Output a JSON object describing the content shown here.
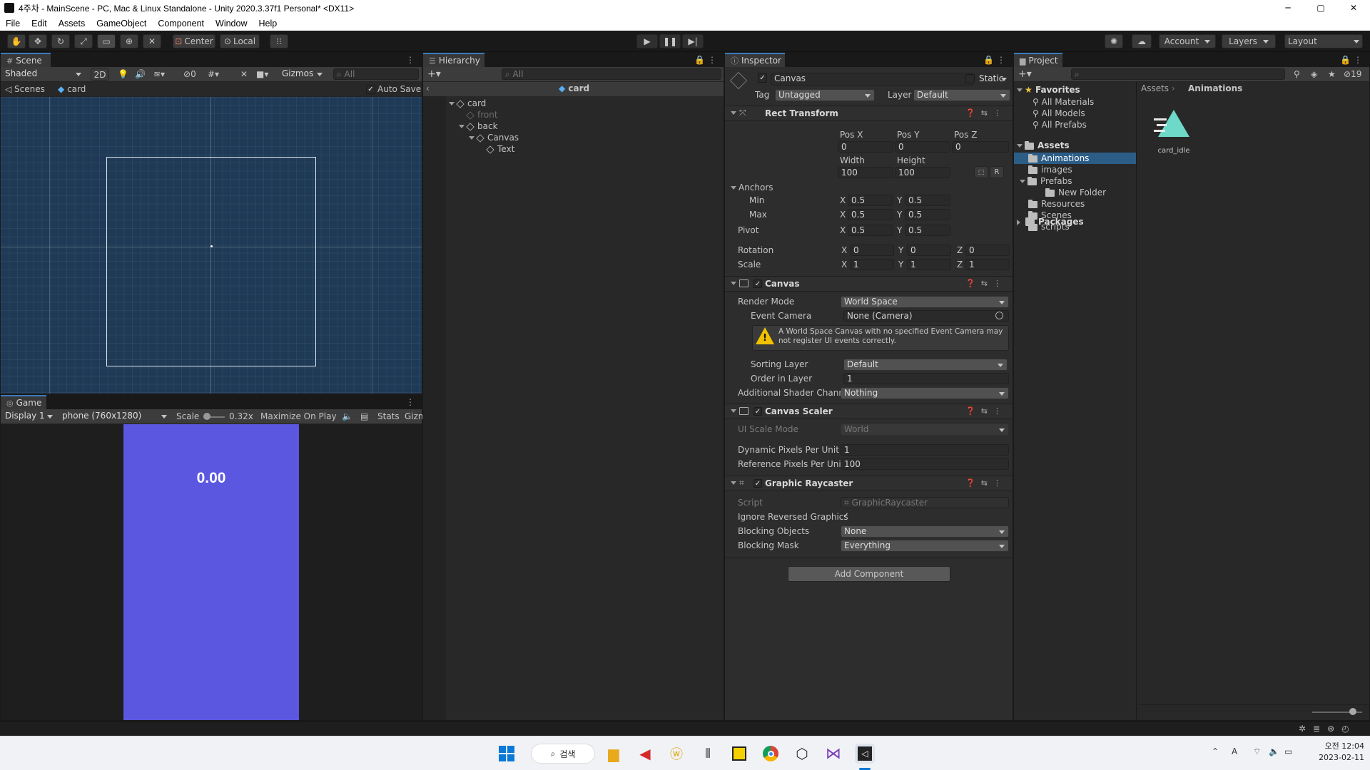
{
  "window": {
    "title": "4주차 - MainScene - PC, Mac & Linux Standalone - Unity 2020.3.37f1 Personal* <DX11>",
    "controls": [
      "─",
      "▢",
      "✕"
    ]
  },
  "menu": [
    "File",
    "Edit",
    "Assets",
    "GameObject",
    "Component",
    "Window",
    "Help"
  ],
  "toolbar": {
    "pivot_mode": "Center",
    "pivot_rotation": "Local",
    "account": "Account",
    "layers": "Layers",
    "layout": "Layout"
  },
  "scene": {
    "tab": "Scene",
    "shading": "Shaded",
    "mode_2d": "2D",
    "hidden_count": "0",
    "gizmos": "Gizmos",
    "search_placeholder": "All",
    "breadcrumb_root": "Scenes",
    "breadcrumb_current": "card",
    "auto_save": "Auto Save",
    "background_color": "#1f3a56"
  },
  "game": {
    "tab": "Game",
    "display": "Display 1",
    "resolution": "phone (760x1280)",
    "scale_label": "Scale",
    "scale_value": "0.32x",
    "maximize": "Maximize On Play",
    "stats": "Stats",
    "gizmos": "Gizm",
    "card_text": "0.00",
    "card_color": "#5b57e0"
  },
  "hierarchy": {
    "tab": "Hierarchy",
    "search_placeholder": "All",
    "title": "card",
    "items": [
      {
        "label": "card",
        "level": 0,
        "expanded": true,
        "dim": false
      },
      {
        "label": "front",
        "level": 1,
        "expanded": false,
        "dim": true
      },
      {
        "label": "back",
        "level": 1,
        "expanded": true,
        "dim": false
      },
      {
        "label": "Canvas",
        "level": 2,
        "expanded": true,
        "dim": false
      },
      {
        "label": "Text",
        "level": 3,
        "expanded": false,
        "dim": false
      }
    ]
  },
  "inspector": {
    "tab": "Inspector",
    "object_name": "Canvas",
    "static_label": "Static",
    "tag_label": "Tag",
    "tag_value": "Untagged",
    "layer_label": "Layer",
    "layer_value": "Default",
    "rect_transform": {
      "title": "Rect Transform",
      "pos_x_label": "Pos X",
      "pos_y_label": "Pos Y",
      "pos_z_label": "Pos Z",
      "pos_x": "0",
      "pos_y": "0",
      "pos_z": "0",
      "width_label": "Width",
      "height_label": "Height",
      "width": "100",
      "height": "100",
      "anchors_label": "Anchors",
      "min_label": "Min",
      "max_label": "Max",
      "min_x": "0.5",
      "min_y": "0.5",
      "max_x": "0.5",
      "max_y": "0.5",
      "pivot_label": "Pivot",
      "pivot_x": "0.5",
      "pivot_y": "0.5",
      "rotation_label": "Rotation",
      "rot_x": "0",
      "rot_y": "0",
      "rot_z": "0",
      "scale_label": "Scale",
      "scale_x": "1",
      "scale_y": "1",
      "scale_z": "1",
      "x": "X",
      "y": "Y",
      "z": "Z",
      "r": "R"
    },
    "canvas": {
      "title": "Canvas",
      "render_mode_label": "Render Mode",
      "render_mode": "World Space",
      "event_camera_label": "Event Camera",
      "event_camera": "None (Camera)",
      "warning": "A World Space Canvas with no specified Event Camera may not register UI events correctly.",
      "sorting_layer_label": "Sorting Layer",
      "sorting_layer": "Default",
      "order_label": "Order in Layer",
      "order": "1",
      "shader_label": "Additional Shader Channe",
      "shader": "Nothing"
    },
    "scaler": {
      "title": "Canvas Scaler",
      "ui_scale_label": "UI Scale Mode",
      "ui_scale": "World",
      "dpu_label": "Dynamic Pixels Per Unit",
      "dpu": "1",
      "rpu_label": "Reference Pixels Per Unit",
      "rpu": "100"
    },
    "raycaster": {
      "title": "Graphic Raycaster",
      "script_label": "Script",
      "script": "GraphicRaycaster",
      "ignore_label": "Ignore Reversed Graphics",
      "blocking_objects_label": "Blocking Objects",
      "blocking_objects": "None",
      "blocking_mask_label": "Blocking Mask",
      "blocking_mask": "Everything"
    },
    "add_component": "Add Component"
  },
  "project": {
    "tab": "Project",
    "hidden_count": "19",
    "favorites_label": "Favorites",
    "favorites": [
      "All Materials",
      "All Models",
      "All Prefabs"
    ],
    "assets_label": "Assets",
    "folders": [
      {
        "label": "Animations",
        "level": 1,
        "selected": true
      },
      {
        "label": "images",
        "level": 1,
        "selected": false
      },
      {
        "label": "Prefabs",
        "level": 1,
        "selected": false
      },
      {
        "label": "New Folder",
        "level": 2,
        "selected": false
      },
      {
        "label": "Resources",
        "level": 1,
        "selected": false
      },
      {
        "label": "Scenes",
        "level": 1,
        "selected": false
      },
      {
        "label": "scripts",
        "level": 1,
        "selected": false
      }
    ],
    "packages_label": "Packages",
    "breadcrumb_root": "Assets",
    "breadcrumb_current": "Animations",
    "asset_name": "card_idle",
    "accent": "#6fd9c9"
  },
  "taskbar": {
    "search": "검색",
    "time": "오전 12:04",
    "date": "2023-02-11",
    "ime": "A"
  }
}
